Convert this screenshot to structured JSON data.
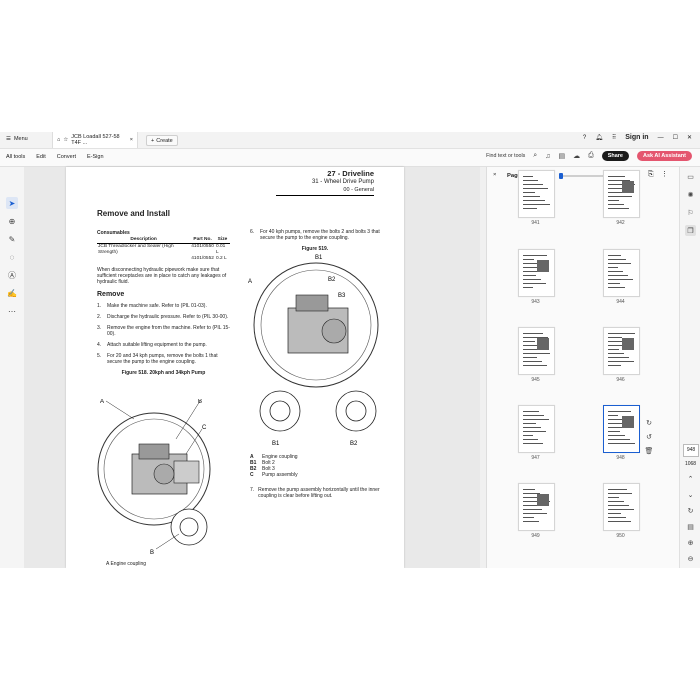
{
  "tabbar": {
    "menu_label": "Menu",
    "doc_tab_title": "JCB Loadall 527-58 T4F ...",
    "create_label": "Create",
    "sign_in": "Sign in"
  },
  "toolbar": {
    "menu_items": [
      "All tools",
      "Edit",
      "Convert",
      "E-Sign"
    ],
    "find_label": "Find text or tools",
    "share_label": "Share",
    "ai_label": "Ask AI Assistant"
  },
  "document": {
    "header_title": "27 - Driveline",
    "header_sub": "31 - Wheel Drive Pump",
    "header_sub2": "00 - General",
    "section_title": "Remove and Install",
    "consumables_label": "Consumables",
    "table_headers": [
      "Description",
      "Part No.",
      "Size"
    ],
    "table_rows": [
      [
        "JCB Threadlocker and Sealer (High Strength)",
        "4101/0550",
        "0.01 L"
      ],
      [
        "",
        "4101/0552",
        "0.2 L"
      ]
    ],
    "intro_para": "When disconnecting hydraulic pipework make sure that sufficient receptacles are in place to catch any leakages of hydraulic fluid.",
    "remove_heading": "Remove",
    "steps": [
      {
        "n": "1.",
        "text": "Make the machine safe. Refer to (PIL 01-03)."
      },
      {
        "n": "2.",
        "text": "Discharge the hydraulic pressure. Refer to (PIL 30-00)."
      },
      {
        "n": "3.",
        "text": "Remove the engine from the machine. Refer to (PIL 15-00)."
      },
      {
        "n": "4.",
        "text": "Attach suitable lifting equipment to the pump."
      },
      {
        "n": "5.",
        "text": "For 20 and 34 kph pumps, remove the bolts 1 that secure the pump to the engine coupling."
      }
    ],
    "fig518_caption": "Figure 518. 20kph and 34kph Pump",
    "step6_n": "6.",
    "step6_text": "For 40 kph pumps, remove the bolts 2 and bolts 3 that secure the pump to the engine coupling.",
    "fig519_caption": "Figure 519.",
    "fig519_labels": [
      "B1",
      "A",
      "B2",
      "B3",
      "B1",
      "B2"
    ],
    "fig518_labels": [
      "A",
      "B",
      "C",
      "B"
    ],
    "legend": [
      {
        "k": "A",
        "v": "Engine coupling"
      },
      {
        "k": "B1",
        "v": "Bolt 2"
      },
      {
        "k": "B2",
        "v": "Bolt 3"
      },
      {
        "k": "C",
        "v": "Pump assembly"
      }
    ],
    "step7_n": "7.",
    "step7_text": "Remove the pump assembly horizontally until the inner coupling is clear before lifting out.",
    "footer_partial": "A    Engine coupling"
  },
  "pages_panel": {
    "title": "Pages",
    "thumbnails": [
      {
        "label": "941",
        "selected": false
      },
      {
        "label": "942",
        "selected": false
      },
      {
        "label": "943",
        "selected": false
      },
      {
        "label": "944",
        "selected": false
      },
      {
        "label": "945",
        "selected": false
      },
      {
        "label": "946",
        "selected": false
      },
      {
        "label": "947",
        "selected": false
      },
      {
        "label": "948",
        "selected": true
      },
      {
        "label": "949",
        "selected": false
      },
      {
        "label": "950",
        "selected": false
      }
    ]
  },
  "page_nav": {
    "current_page": "948",
    "total_pages": "1068"
  },
  "colors": {
    "accent": "#1b5fd1",
    "ai_button": "#e4566f",
    "share_button": "#1a1a1a"
  }
}
